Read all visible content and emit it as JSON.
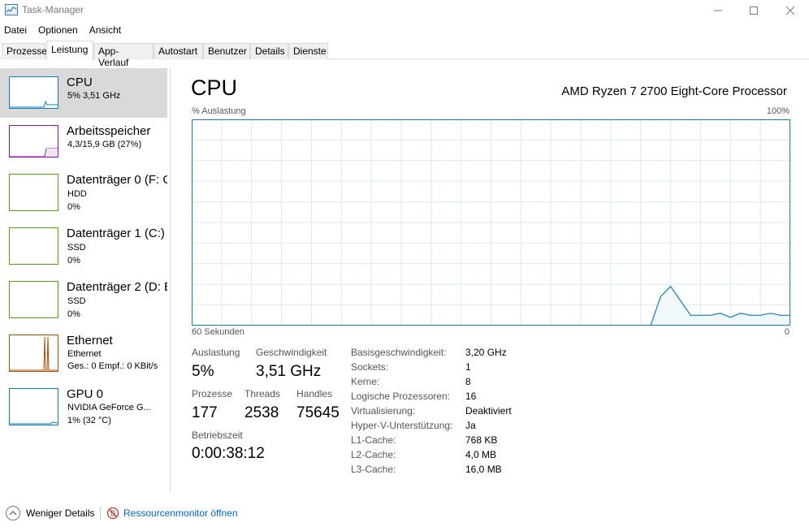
{
  "window": {
    "title": "Task-Manager"
  },
  "menu": [
    "Datei",
    "Optionen",
    "Ansicht"
  ],
  "tabs": [
    "Prozesse",
    "Leistung",
    "App-Verlauf",
    "Autostart",
    "Benutzer",
    "Details",
    "Dienste"
  ],
  "active_tab": "Leistung",
  "sidebar": [
    {
      "title": "CPU",
      "lines": [
        "5% 3,51 GHz"
      ],
      "color": "#117dbb",
      "selected": true
    },
    {
      "title": "Arbeitsspeicher",
      "lines": [
        "4,3/15,9 GB (27%)"
      ],
      "color": "#8b12ae"
    },
    {
      "title": "Datenträger 0 (F: G",
      "lines": [
        "HDD",
        "0%"
      ],
      "color": "#4da60c"
    },
    {
      "title": "Datenträger 1 (C:)",
      "lines": [
        "SSD",
        "0%"
      ],
      "color": "#4da60c"
    },
    {
      "title": "Datenträger 2 (D: E",
      "lines": [
        "SSD",
        "0%"
      ],
      "color": "#4da60c"
    },
    {
      "title": "Ethernet",
      "lines": [
        "Ethernet",
        "Ges.: 0 Empf.: 0 KBit/s"
      ],
      "color": "#a74f01"
    },
    {
      "title": "GPU 0",
      "lines": [
        "NVIDIA GeForce G...",
        "1% (32 °C)"
      ],
      "color": "#117dbb"
    }
  ],
  "main": {
    "title": "CPU",
    "processor": "AMD Ryzen 7 2700 Eight-Core Processor",
    "axis_label": "% Auslastung",
    "axis_max": "100%",
    "time_label": "60 Sekunden",
    "axis_min": "0",
    "graph_color": "#117dbb",
    "grid_color": "#d9eaf4"
  },
  "chart_data": {
    "type": "area",
    "title": "",
    "xlabel": "60 Sekunden",
    "ylabel": "% Auslastung",
    "ylim": [
      0,
      100
    ],
    "xlim": [
      60,
      0
    ],
    "x": [
      60,
      58,
      56,
      54,
      52,
      50,
      48,
      46,
      44,
      42,
      40,
      38,
      36,
      34,
      32,
      30,
      28,
      26,
      24,
      22,
      20,
      18,
      16,
      14,
      13,
      12,
      10,
      9,
      8,
      7,
      6,
      5,
      4,
      3,
      2,
      1,
      0
    ],
    "values": [
      0,
      0,
      0,
      0,
      0,
      0,
      0,
      0,
      0,
      0,
      0,
      0,
      0,
      0,
      0,
      0,
      0,
      0,
      0,
      0,
      0,
      0,
      0,
      0,
      14,
      19,
      5,
      5,
      5,
      6,
      4,
      6,
      5,
      5,
      6,
      5,
      5
    ],
    "grid": true
  },
  "stats": {
    "auslastung_label": "Auslastung",
    "auslastung": "5%",
    "geschw_label": "Geschwindigkeit",
    "geschw": "3,51 GHz",
    "prozesse_label": "Prozesse",
    "prozesse": "177",
    "threads_label": "Threads",
    "threads": "2538",
    "handles_label": "Handles",
    "handles": "75645",
    "betrieb_label": "Betriebszeit",
    "betrieb": "0:00:38:12"
  },
  "specs": [
    {
      "label": "Basisgeschwindigkeit:",
      "value": "3,20 GHz"
    },
    {
      "label": "Sockets:",
      "value": "1"
    },
    {
      "label": "Kerne:",
      "value": "8"
    },
    {
      "label": "Logische Prozessoren:",
      "value": "16"
    },
    {
      "label": "Virtualisierung:",
      "value": "Deaktiviert"
    },
    {
      "label": "Hyper-V-Unterstützung:",
      "value": "Ja"
    },
    {
      "label": "L1-Cache:",
      "value": "768 KB"
    },
    {
      "label": "L2-Cache:",
      "value": "4,0 MB"
    },
    {
      "label": "L3-Cache:",
      "value": "16,0 MB"
    }
  ],
  "footer": {
    "fewer": "Weniger Details",
    "resmon": "Ressourcenmonitor öffnen"
  }
}
